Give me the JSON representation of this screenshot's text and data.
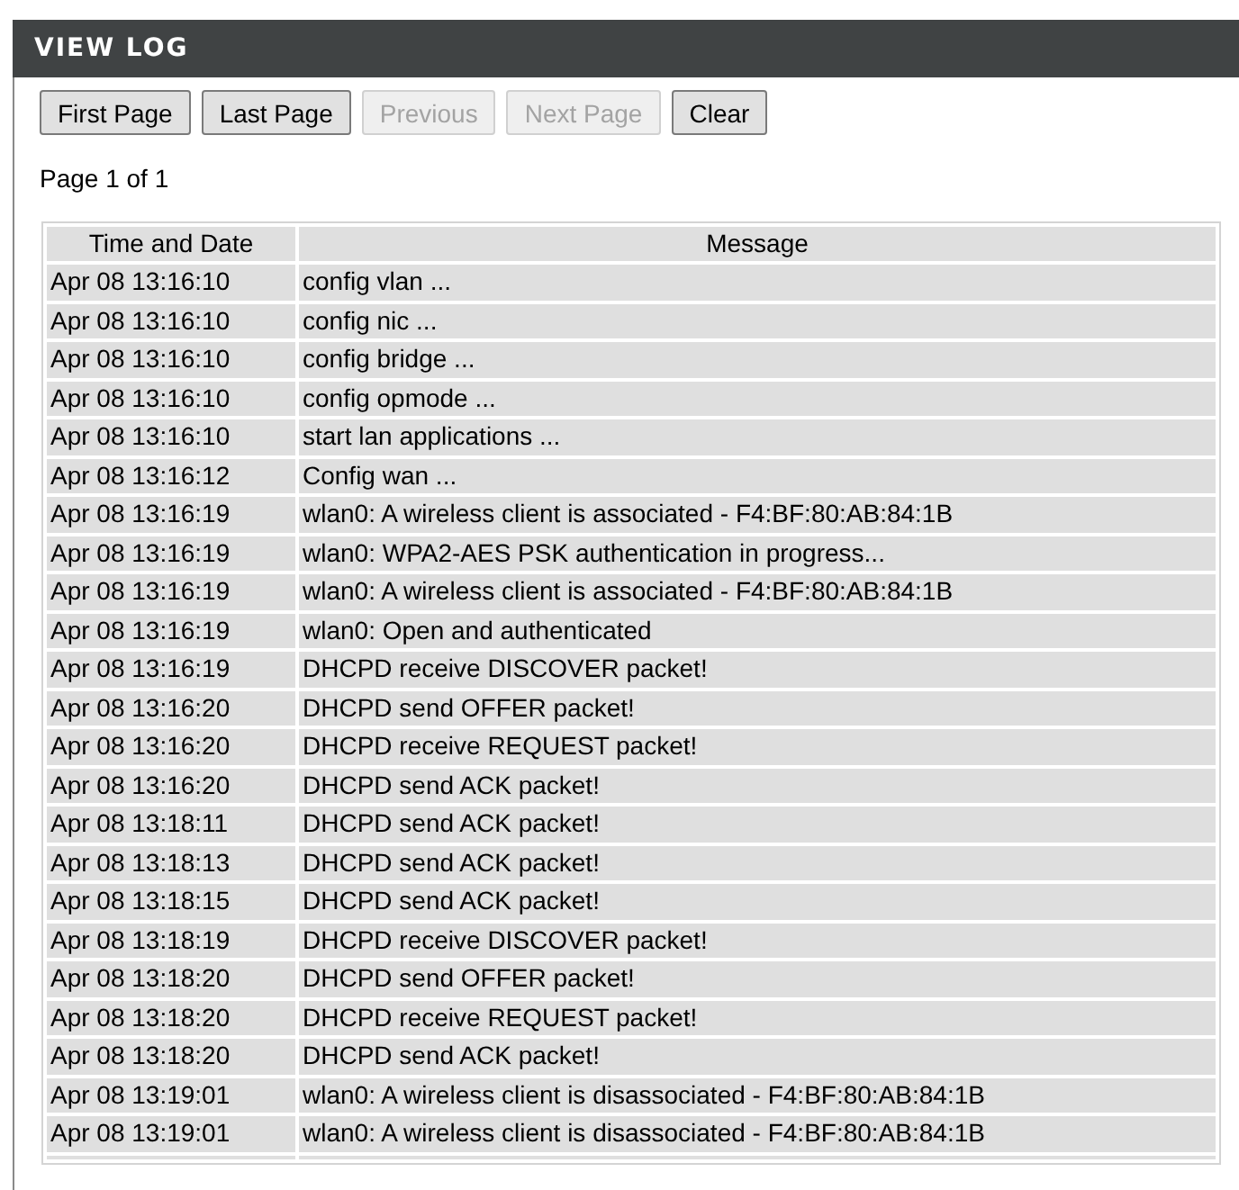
{
  "panel": {
    "title": "VIEW LOG"
  },
  "buttons": [
    {
      "label": "First Page",
      "disabled": false
    },
    {
      "label": "Last Page",
      "disabled": false
    },
    {
      "label": "Previous",
      "disabled": true
    },
    {
      "label": "Next Page",
      "disabled": true
    },
    {
      "label": "Clear",
      "disabled": false
    }
  ],
  "page_info": "Page 1 of 1",
  "table": {
    "columns": [
      "Time and Date",
      "Message"
    ],
    "rows": [
      {
        "time": "Apr 08 13:16:10",
        "message": "config vlan ..."
      },
      {
        "time": "Apr 08 13:16:10",
        "message": "config nic ..."
      },
      {
        "time": "Apr 08 13:16:10",
        "message": "config bridge ..."
      },
      {
        "time": "Apr 08 13:16:10",
        "message": "config opmode ..."
      },
      {
        "time": "Apr 08 13:16:10",
        "message": "start lan applications ..."
      },
      {
        "time": "Apr 08 13:16:12",
        "message": "Config wan ..."
      },
      {
        "time": "Apr 08 13:16:19",
        "message": "wlan0: A wireless client is associated - F4:BF:80:AB:84:1B"
      },
      {
        "time": "Apr 08 13:16:19",
        "message": "wlan0: WPA2-AES PSK authentication in progress..."
      },
      {
        "time": "Apr 08 13:16:19",
        "message": "wlan0: A wireless client is associated - F4:BF:80:AB:84:1B"
      },
      {
        "time": "Apr 08 13:16:19",
        "message": "wlan0: Open and authenticated"
      },
      {
        "time": "Apr 08 13:16:19",
        "message": "DHCPD receive DISCOVER packet!"
      },
      {
        "time": "Apr 08 13:16:20",
        "message": "DHCPD send OFFER packet!"
      },
      {
        "time": "Apr 08 13:16:20",
        "message": "DHCPD receive REQUEST packet!"
      },
      {
        "time": "Apr 08 13:16:20",
        "message": "DHCPD send ACK packet!"
      },
      {
        "time": "Apr 08 13:18:11",
        "message": "DHCPD send ACK packet!"
      },
      {
        "time": "Apr 08 13:18:13",
        "message": "DHCPD send ACK packet!"
      },
      {
        "time": "Apr 08 13:18:15",
        "message": "DHCPD send ACK packet!"
      },
      {
        "time": "Apr 08 13:18:19",
        "message": "DHCPD receive DISCOVER packet!"
      },
      {
        "time": "Apr 08 13:18:20",
        "message": "DHCPD send OFFER packet!"
      },
      {
        "time": "Apr 08 13:18:20",
        "message": "DHCPD receive REQUEST packet!"
      },
      {
        "time": "Apr 08 13:18:20",
        "message": "DHCPD send ACK packet!"
      },
      {
        "time": "Apr 08 13:19:01",
        "message": "wlan0: A wireless client is disassociated - F4:BF:80:AB:84:1B"
      },
      {
        "time": "Apr 08 13:19:01",
        "message": "wlan0: A wireless client is disassociated - F4:BF:80:AB:84:1B"
      }
    ]
  }
}
